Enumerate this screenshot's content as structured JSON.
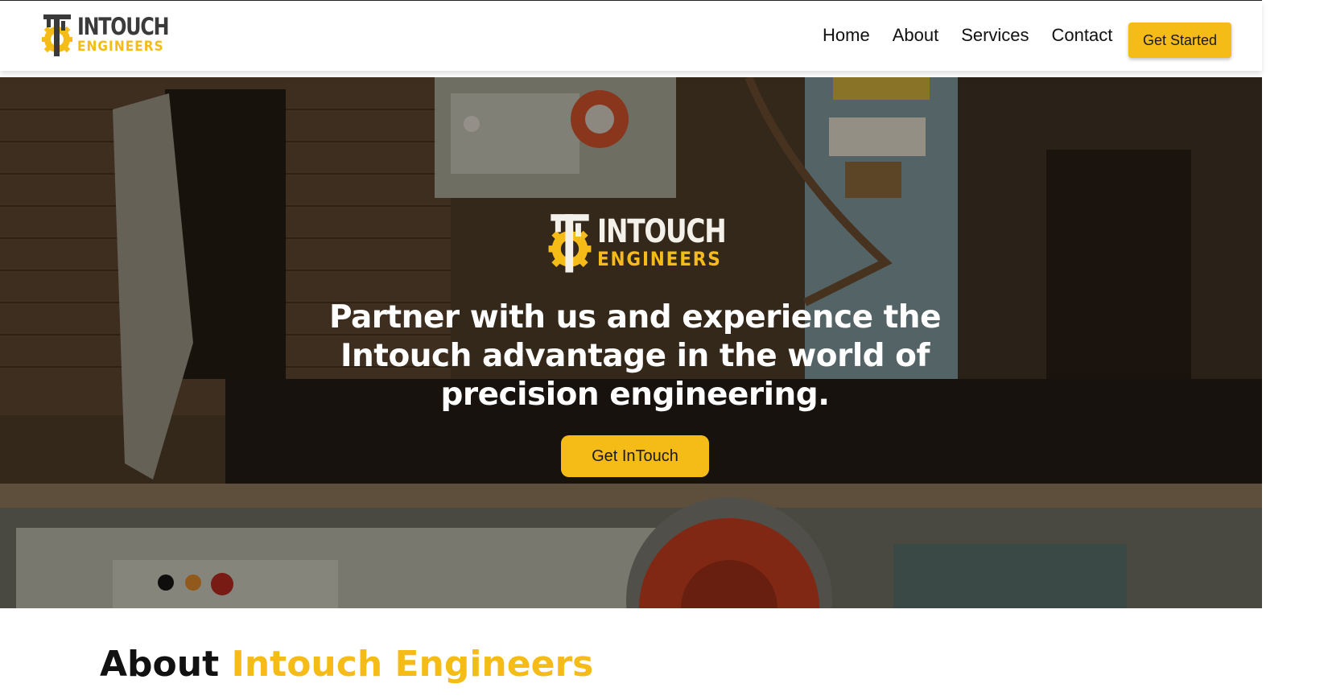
{
  "brand": {
    "name_line1": "INTOUCH",
    "name_line2": "ENGINEERS",
    "dark_color": "#3a3a3a",
    "accent_color": "#f5bb17"
  },
  "nav": {
    "items": [
      "Home",
      "About",
      "Services",
      "Contact"
    ],
    "cta_label": "Get Started"
  },
  "hero": {
    "logo_line1": "INTOUCH",
    "logo_line2": "ENGINEERS",
    "headline": "Partner with us and experience the Intouch advantage in the world of precision engineering.",
    "button_label": "Get InTouch",
    "background": "industrial-grinding-machine-photo"
  },
  "about": {
    "heading_prefix": "About",
    "heading_accent": "Intouch Engineers"
  }
}
